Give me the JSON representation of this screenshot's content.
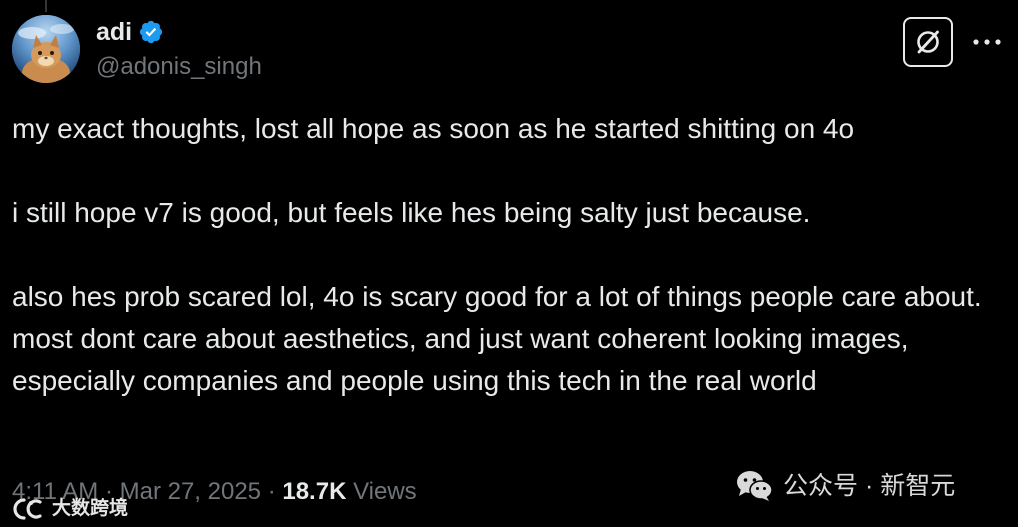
{
  "author": {
    "display_name": "adi",
    "handle": "@adonis_singh",
    "verified_icon": "verified-badge-icon",
    "verified_color": "#1d9bf0"
  },
  "actions": {
    "grok_icon": "grok-icon",
    "more_icon": "more-horizontal-icon",
    "more_label": "···"
  },
  "tweet": {
    "paragraphs": [
      "my exact thoughts, lost all hope as soon as he started shitting on 4o",
      "i still hope v7 is good, but feels like hes being salty just because.",
      "also hes prob scared lol, 4o is scary good for a lot of things people care about. most dont care about aesthetics, and just want coherent looking images, especially companies and people using this tech in the real world"
    ]
  },
  "meta": {
    "time": "4:11 AM",
    "separator": " · ",
    "date": "Mar 27, 2025",
    "views_count": "18.7K",
    "views_label": "Views"
  },
  "watermarks": {
    "wechat": "公众号 · 新智元",
    "bigdata": "大数跨境"
  },
  "colors": {
    "background": "#000000",
    "text_primary": "#e7e9ea",
    "text_secondary": "#71767b"
  }
}
